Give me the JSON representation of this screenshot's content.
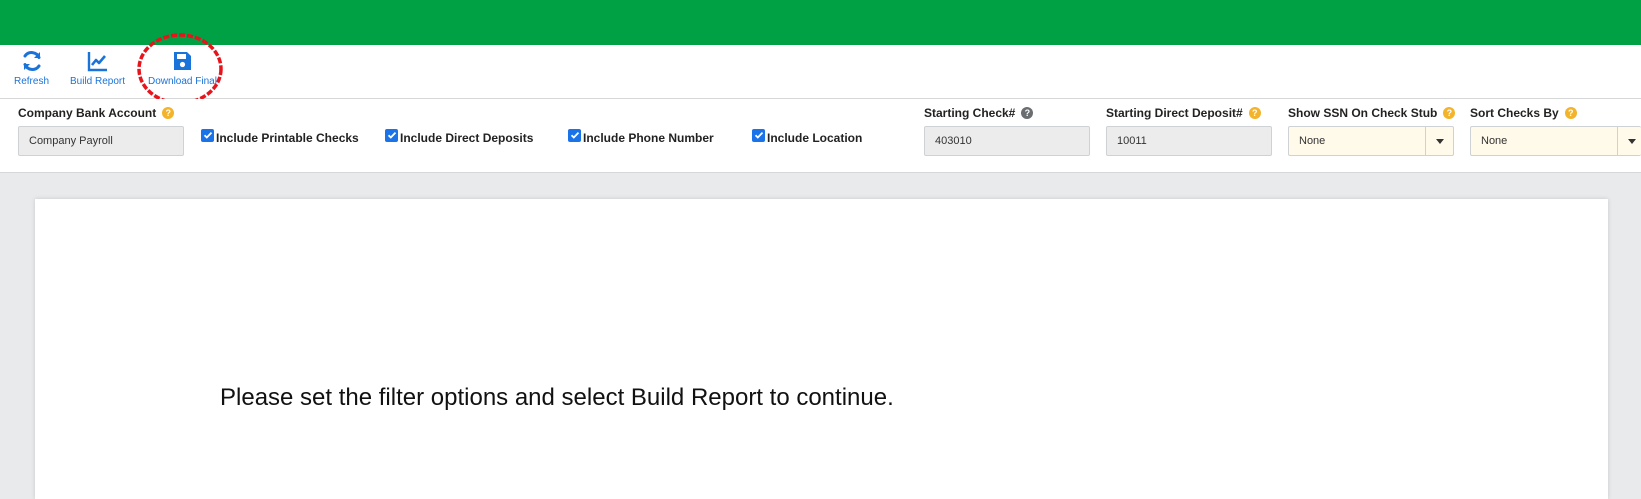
{
  "toolbar": {
    "refresh_label": "Refresh",
    "build_report_label": "Build Report",
    "download_final_label": "Download Final"
  },
  "filters": {
    "company_bank_account": {
      "label": "Company Bank Account",
      "value": "Company Payroll"
    },
    "checkboxes": [
      {
        "label": "Include Printable Checks",
        "checked": true
      },
      {
        "label": "Include Direct Deposits",
        "checked": true
      },
      {
        "label": "Include Phone Number",
        "checked": true
      },
      {
        "label": "Include Location",
        "checked": true
      }
    ],
    "starting_check": {
      "label": "Starting Check#",
      "value": "403010"
    },
    "starting_direct_deposit": {
      "label": "Starting Direct Deposit#",
      "value": "10011"
    },
    "show_ssn": {
      "label": "Show SSN On Check Stub",
      "value": "None"
    },
    "sort_checks_by": {
      "label": "Sort Checks By",
      "value": "None"
    }
  },
  "report": {
    "message": "Please set the filter options and select Build Report to continue."
  },
  "colors": {
    "brand_green": "#00a044",
    "accent_blue": "#1a73d8",
    "help_yellow": "#f3b32a",
    "highlight_red": "#e8141c"
  },
  "icons": [
    "refresh-icon",
    "chart-line-icon",
    "save-icon",
    "help-icon",
    "checkmark-icon",
    "caret-down-icon"
  ]
}
